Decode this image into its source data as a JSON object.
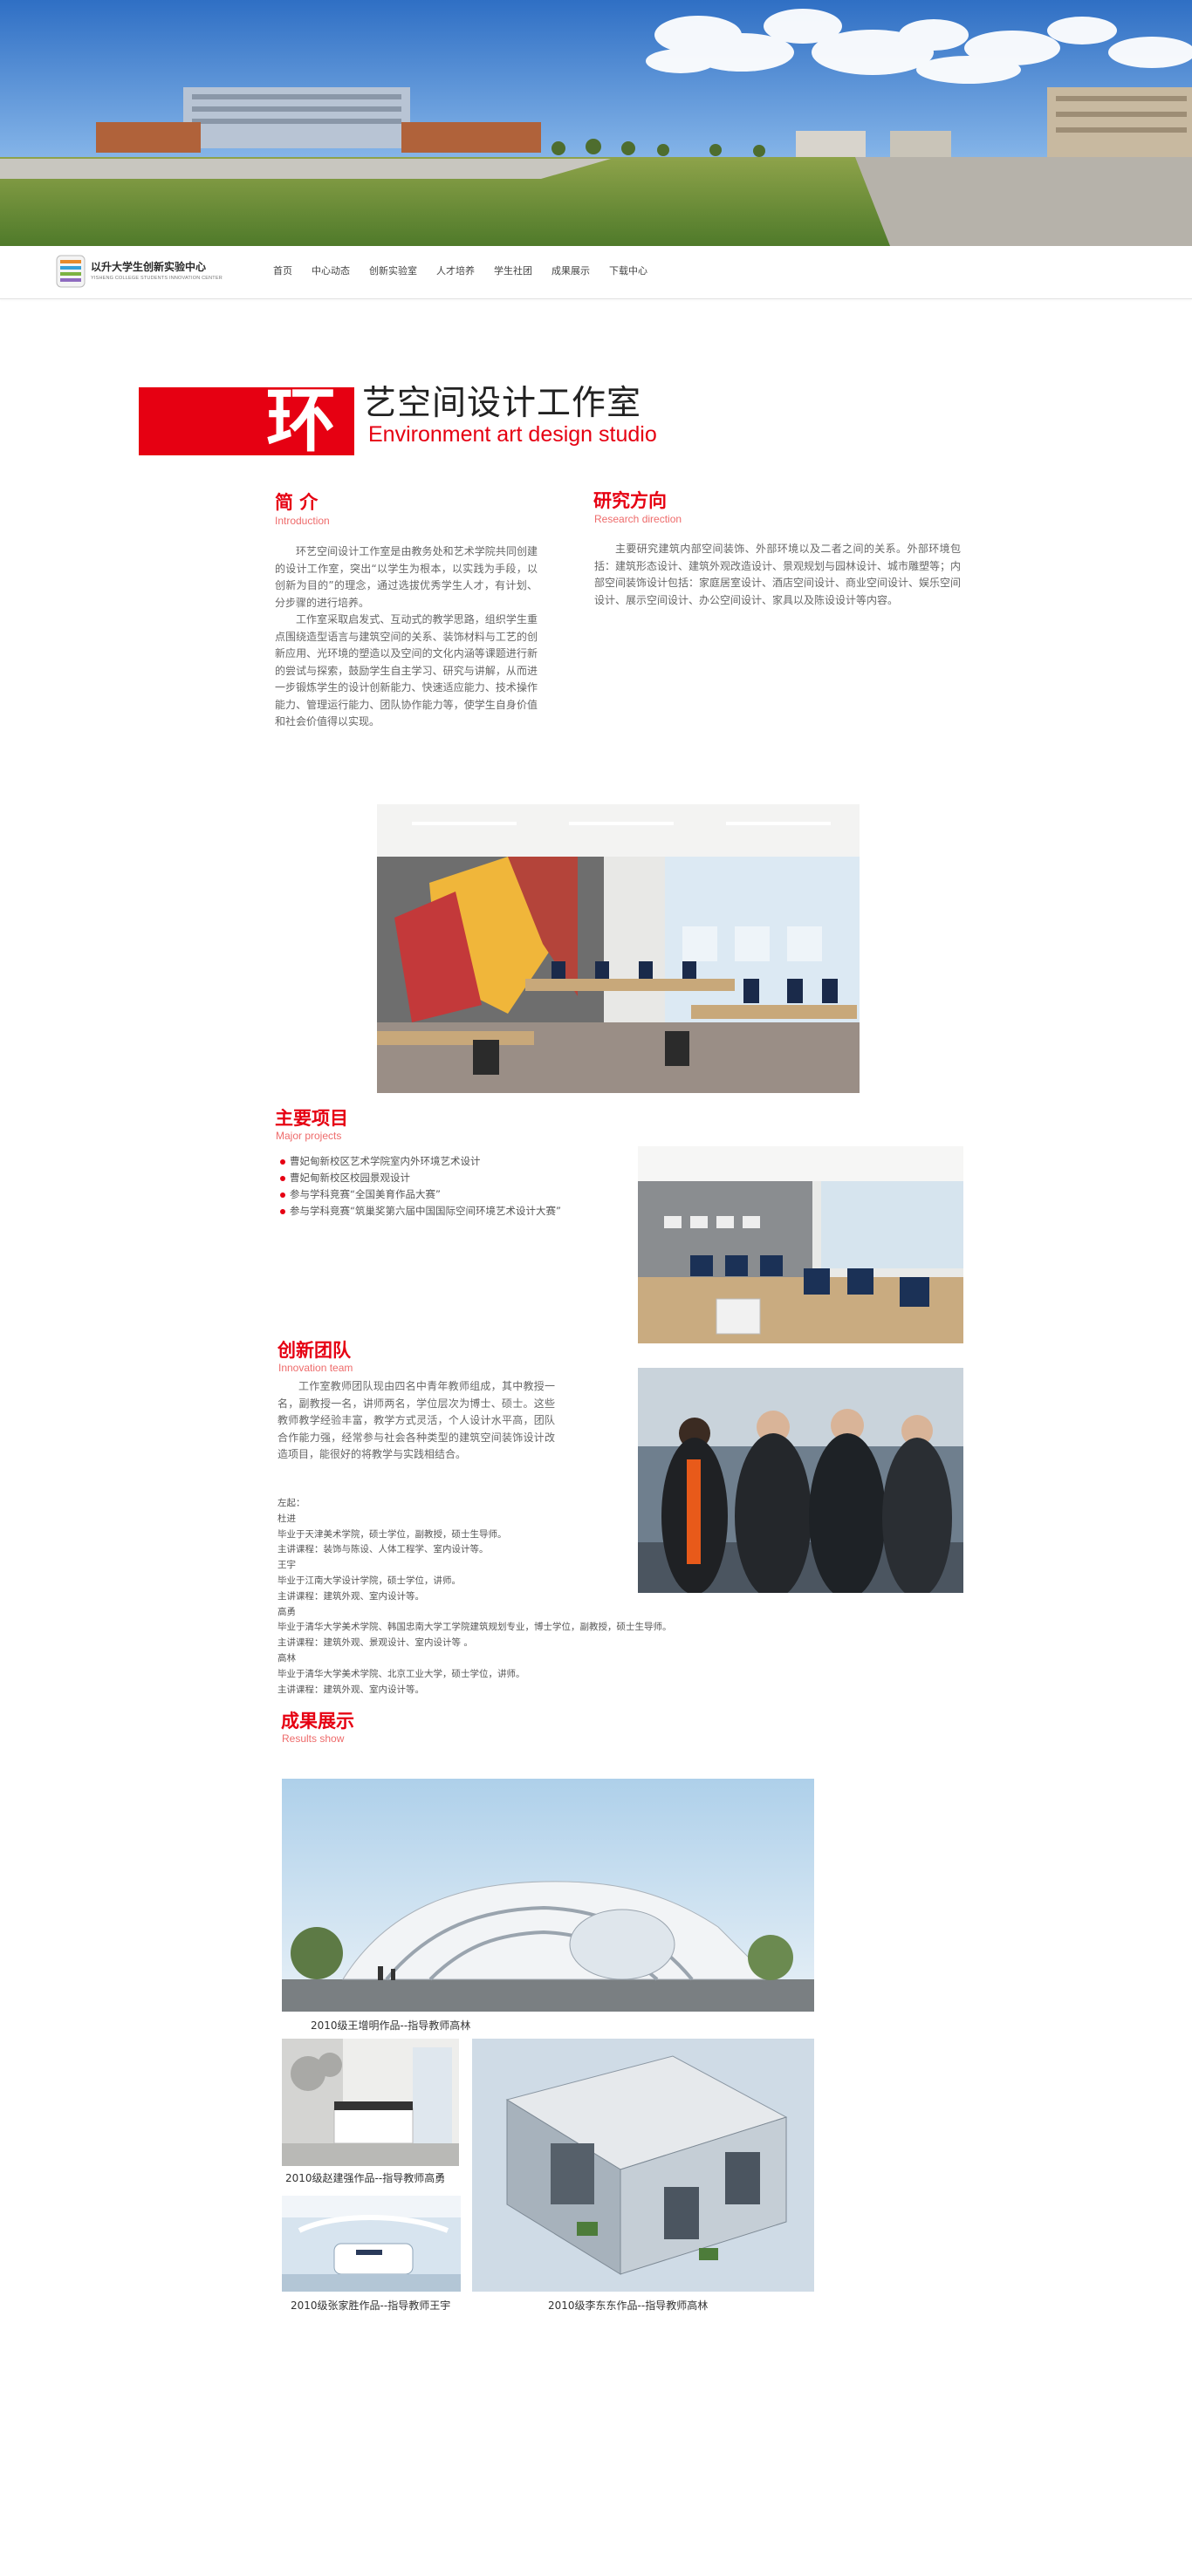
{
  "header": {
    "logo_name": "以升大学生创新实验中心",
    "logo_sub": "YISHENG COLLEGE STUDENTS INNOVATION CENTER",
    "nav": [
      "首页",
      "中心动态",
      "创新实验室",
      "人才培养",
      "学生社团",
      "成果展示",
      "下载中心"
    ]
  },
  "studio": {
    "char": "环",
    "title": "艺空间设计工作室",
    "title_en": "Environment art design studio"
  },
  "intro": {
    "title": "简 介",
    "subtitle": "Introduction",
    "paragraphs": [
      "环艺空间设计工作室是由教务处和艺术学院共同创建的设计工作室，突出“以学生为根本，以实践为手段，以创新为目的”的理念，通过选拔优秀学生人才，有计划、分步骤的进行培养。",
      "工作室采取启发式、互动式的教学思路，组织学生重点围绕造型语言与建筑空间的关系、装饰材料与工艺的创新应用、光环境的塑造以及空间的文化内涵等课题进行新的尝试与探索，鼓励学生自主学习、研究与讲解，从而进一步锻炼学生的设计创新能力、快速适应能力、技术操作能力、管理运行能力、团队协作能力等，使学生自身价值和社会价值得以实现。"
    ]
  },
  "research": {
    "title": "研究方向",
    "subtitle": "Research direction",
    "paragraphs": [
      "主要研究建筑内部空间装饰、外部环境以及二者之间的关系。外部环境包括：建筑形态设计、建筑外观改造设计、景观规划与园林设计、城市雕塑等；内部空间装饰设计包括：家庭居室设计、酒店空间设计、商业空间设计、娱乐空间设计、展示空间设计、办公空间设计、家具以及陈设设计等内容。"
    ]
  },
  "projects": {
    "title": "主要项目",
    "subtitle": "Major projects",
    "items": [
      "曹妃甸新校区艺术学院室内外环境艺术设计",
      "曹妃甸新校区校园景观设计",
      "参与学科竞赛“全国美育作品大赛”",
      "参与学科竞赛“筑巢奖第六届中国国际空间环境艺术设计大赛”"
    ]
  },
  "team": {
    "title": "创新团队",
    "subtitle": "Innovation team",
    "intro": "工作室教师团队现由四名中青年教师组成，其中教授一名，副教授一名，讲师两名，学位层次为博士、硕士。这些教师教学经验丰富，教学方式灵活，个人设计水平高，团队合作能力强，经常参与社会各种类型的建筑空间装饰设计改造项目，能很好的将教学与实践相结合。",
    "members": [
      "左起：",
      "杜进",
      "毕业于天津美术学院，硕士学位，副教授，硕士生导师。",
      "主讲课程：装饰与陈设、人体工程学、室内设计等。",
      "王宇",
      "毕业于江南大学设计学院，硕士学位，讲师。",
      "主讲课程：建筑外观、室内设计等。",
      "高勇",
      "毕业于清华大学美术学院、韩国忠南大学工学院建筑规划专业，博士学位，副教授，硕士生导师。",
      "主讲课程：建筑外观、景观设计、室内设计等 。",
      "高林",
      "毕业于清华大学美术学院、北京工业大学，硕士学位，讲师。",
      "主讲课程：建筑外观、室内设计等。"
    ]
  },
  "results": {
    "title": "成果展示",
    "subtitle": "Results show",
    "captions": [
      "2010级王增明作品--指导教师高林",
      "2010级赵建强作品--指导教师高勇",
      "2010级李东东作品--指导教师高林",
      "2010级张家胜作品--指导教师王宇"
    ]
  },
  "colors": {
    "accent": "#e60012",
    "accent_light": "#ee6b6b",
    "text": "#666666"
  }
}
